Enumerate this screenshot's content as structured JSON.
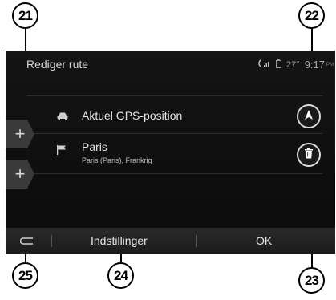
{
  "screen": {
    "title": "Rediger rute",
    "status": {
      "temperature": "27°",
      "time": "9:17",
      "ampm": "PM"
    }
  },
  "route": [
    {
      "label": "Aktuel GPS-position",
      "sublabel": "",
      "icon": "car-icon"
    },
    {
      "label": "Paris",
      "sublabel": "Paris (Paris), Frankrig",
      "icon": "flag-icon"
    }
  ],
  "bottom_bar": {
    "settings_label": "Indstillinger",
    "ok_label": "OK"
  },
  "callouts": {
    "c21": "21",
    "c22": "22",
    "c23": "23",
    "c24": "24",
    "c25": "25"
  }
}
